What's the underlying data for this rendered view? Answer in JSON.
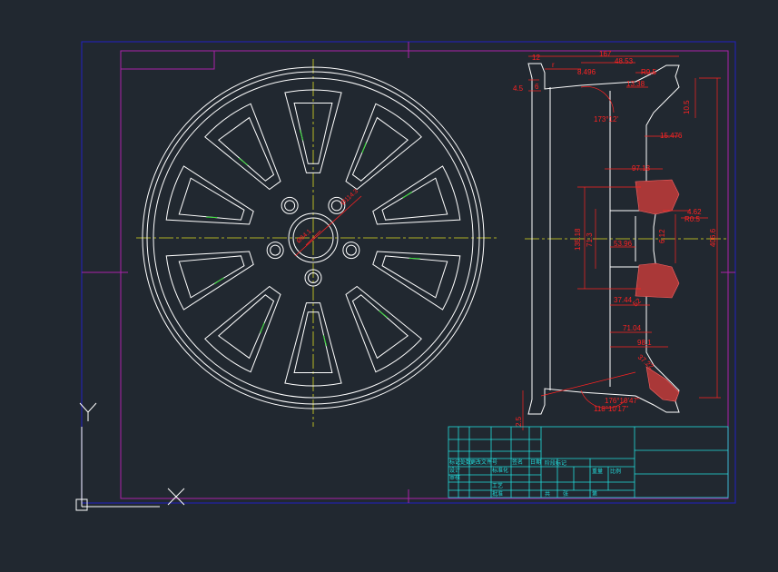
{
  "colors": {
    "background": "#212830",
    "outer_frame": "#2222aa",
    "inner_frame": "#aa22aa",
    "geometry": "#ffffff",
    "centerline": "#dddd22",
    "dimension": "#ff2222",
    "hidden_edge": "#33dd33",
    "title_block": "#22dddd",
    "ucs": "#ffffff"
  },
  "ucs": {
    "y_label": "Y"
  },
  "side_view": {
    "dimensions": {
      "d_top_12": "12",
      "d_167": "167",
      "d_48_53": "48.53",
      "d_r": "r",
      "d_8_496": "8.496",
      "d_r9_5": "R9.5",
      "d_6a": "6",
      "d_13_38": "13.38",
      "d_4_5": "4.5",
      "d_173": "173°12'",
      "d_10_5": "10.5",
      "d_15_476": "15.476",
      "d_97_13": "97.13",
      "d_135_18": "135.18",
      "d_71_3": "71.3",
      "d_53_96": "53.96",
      "d_6_12": "6.12",
      "d_r0_5": "R0.5",
      "d_4_62": "4.62",
      "d_406": "406.6",
      "d_37_44": "37.44",
      "d_52": "52",
      "d_71_04": "71.04",
      "d_98_1": "98.1",
      "d_37_22": "37.22",
      "d_176": "176°10'47\"",
      "d_118": "118°10'17\"",
      "d_2_5": "2.5"
    }
  },
  "front_view": {
    "dimensions": {
      "d_bolt_circle": "Ø114.3",
      "d_center_bore": "Ø64.1"
    }
  },
  "title_block": {
    "cells": {
      "r1": "标记处数",
      "r2": "更改文件号",
      "r3": "签名",
      "r4": "日期",
      "r5": "设计",
      "r6": "标准化",
      "r7": "阶段标记",
      "r8": "重量",
      "r9": "比例",
      "r10": "审核",
      "r11": "工艺",
      "r12": "批准",
      "r13": "共",
      "r14": "张",
      "r15": "第"
    }
  }
}
